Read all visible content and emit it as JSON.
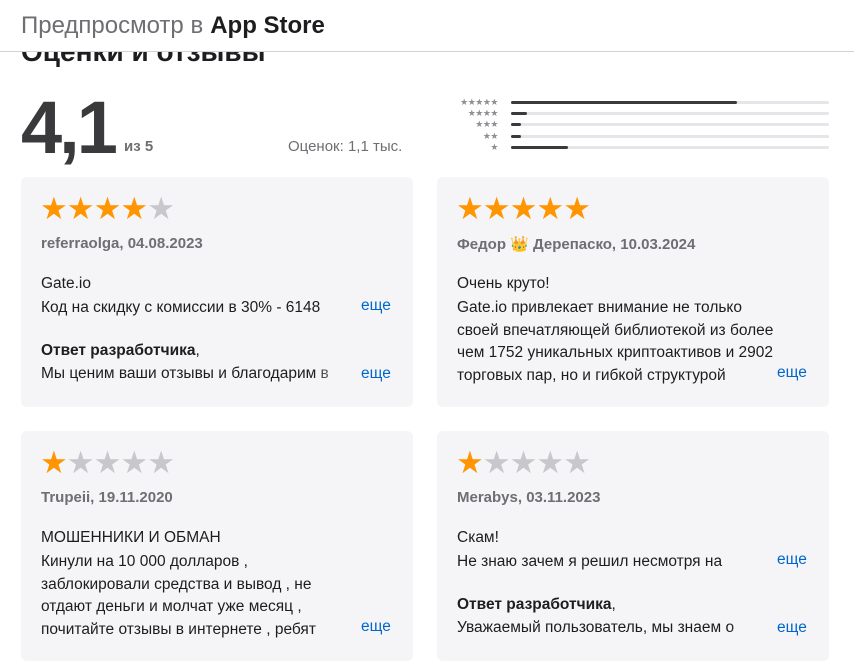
{
  "header": {
    "prefix": "Предпросмотр в",
    "brand": "App Store"
  },
  "section_title": "Оценки и отзывы",
  "rating": {
    "average": "4,1",
    "out_of": "из 5",
    "count": "Оценок: 1,1 тыс."
  },
  "histogram": [
    {
      "stars": "★★★★★",
      "fraction": 0.71
    },
    {
      "stars": "★★★★",
      "fraction": 0.05
    },
    {
      "stars": "★★★",
      "fraction": 0.03
    },
    {
      "stars": "★★",
      "fraction": 0.03
    },
    {
      "stars": "★",
      "fraction": 0.18
    }
  ],
  "colors": {
    "star_on": "#ff9500",
    "star_off": "#c7c7cc",
    "link": "#0066cc",
    "card_bg": "#f5f5f7"
  },
  "reviews": [
    {
      "rating": 4,
      "meta": "referraolga, 04.08.2023",
      "title": "Gate.io",
      "body": [
        "Код на скидку с комиссии в 30% - 6148"
      ],
      "dev_head": "Ответ разработчика",
      "dev_tail": ",",
      "dev_body": "Мы ценим ваши отзывы и благодарим в",
      "more": "еще",
      "dev_more": "еще"
    },
    {
      "rating": 5,
      "meta": "Федор 👑 Дерепаско, 10.03.2024",
      "title": "Очень круто!",
      "body": [
        "Gate.io привлекает внимание не только",
        "своей впечатляющей библиотекой из более",
        "чем 1752 уникальных криптоактивов и 2902",
        "торговых пар, но и гибкой структурой"
      ],
      "more": "еще"
    },
    {
      "rating": 1,
      "meta": "Trupeii, 19.11.2020",
      "title": "МОШЕННИКИ И ОБМАН",
      "body": [
        "Кинули на 10 000 долларов ,",
        "заблокировали средства и вывод , не",
        "отдают деньги и молчат уже месяц ,",
        "почитайте отзывы в интернете , ребят"
      ],
      "more": "еще"
    },
    {
      "rating": 1,
      "meta": "Merabys, 03.11.2023",
      "title": "Скам!",
      "body": [
        "Не знаю зачем я решил несмотря на"
      ],
      "dev_head": "Ответ разработчика",
      "dev_tail": ",",
      "dev_body": "Уважаемый пользователь, мы знаем о",
      "more": "еще",
      "dev_more": "еще"
    }
  ]
}
